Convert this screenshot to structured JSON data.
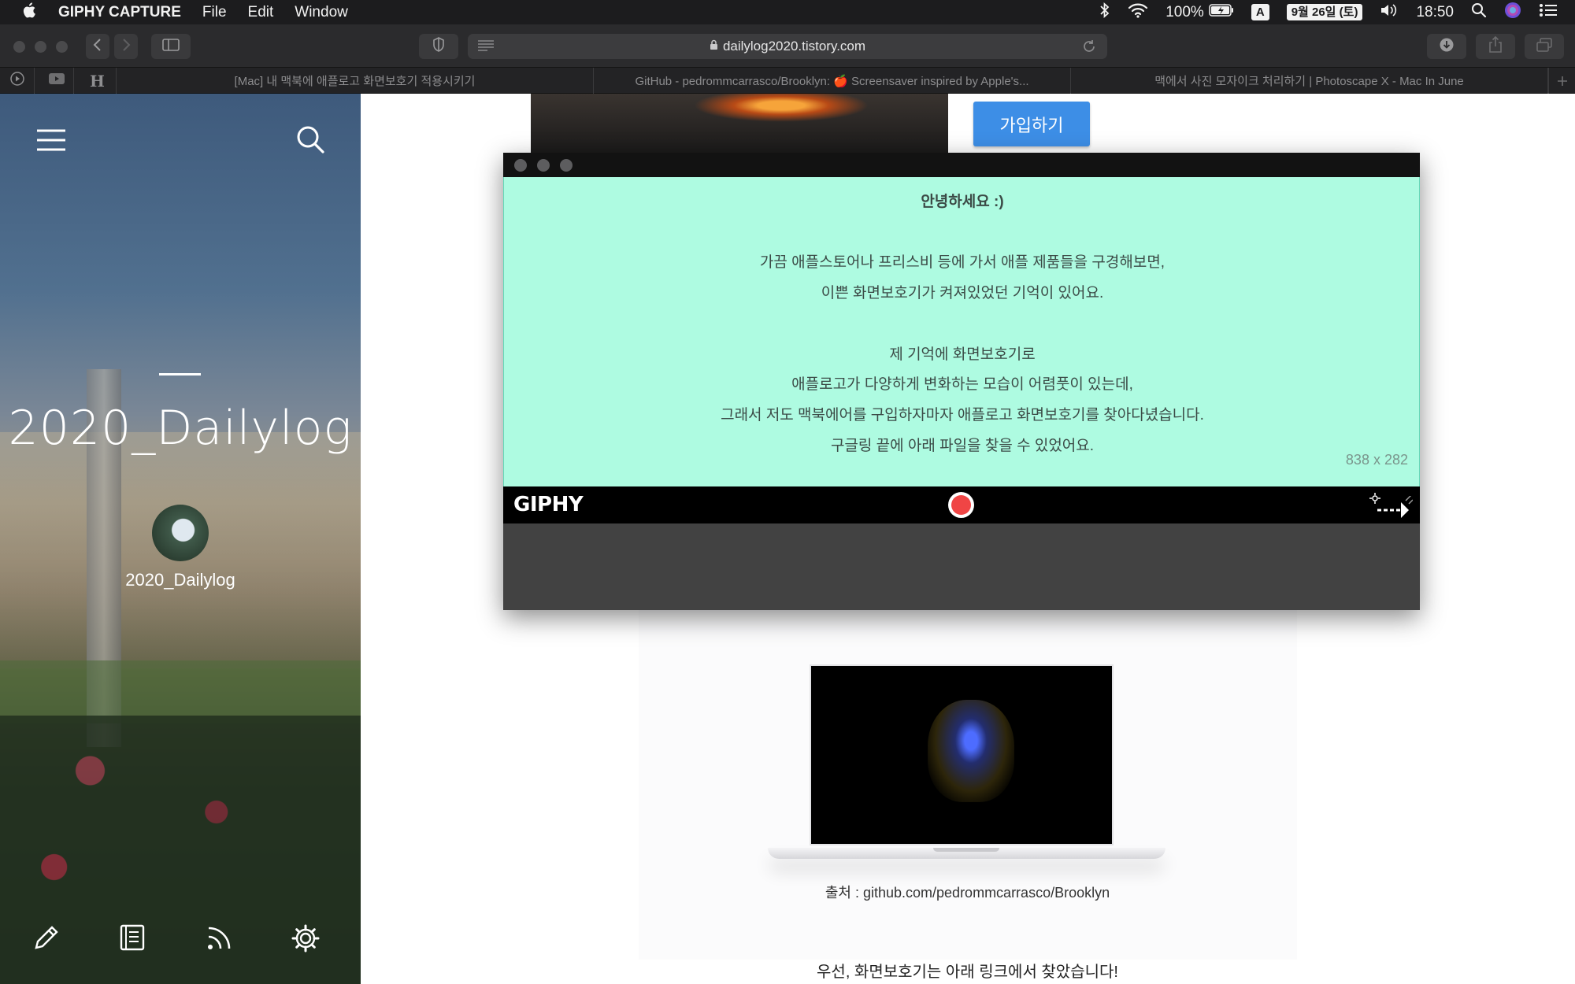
{
  "menubar": {
    "app_name": "GIPHY CAPTURE",
    "menus": [
      "File",
      "Edit",
      "Window"
    ],
    "battery": "100%",
    "input_source": "A",
    "date": "9월 26일 (토)",
    "time": "18:50"
  },
  "browser": {
    "url": "dailylog2020.tistory.com",
    "pinned_tabs": [
      "",
      "",
      "H"
    ],
    "tabs": [
      "[Mac] 내 맥북에 애플로고 화면보호기 적용시키기",
      "GitHub - pedrommcarrasco/Brooklyn: 🍎 Screensaver inspired by Apple's...",
      "맥에서 사진 모자이크 처리하기 | Photoscape X - Mac In June"
    ]
  },
  "sidebar": {
    "blog_title": "2020_Dailylog",
    "nickname": "2020_Dailylog"
  },
  "page": {
    "join_button": "가입하기",
    "caption_source": "출처 : github.com/pedrommcarrasco/Brooklyn",
    "caption_link": "우선, 화면보호기는 아래 링크에서 찾았습니다!"
  },
  "giphy": {
    "logo": "GIPHY",
    "capture_size": "838 x 282",
    "capture_text": {
      "greeting": "안녕하세요 :)",
      "line1": "가끔 애플스토어나 프리스비 등에 가서 애플 제품들을 구경해보면,",
      "line2": "이쁜 화면보호기가 켜져있었던 기억이 있어요.",
      "line3": "제 기억에 화면보호기로",
      "line4": "애플로고가 다양하게 변화하는 모습이 어렴풋이 있는데,",
      "line5": "그래서 저도 맥북에어를 구입하자마자 애플로고 화면보호기를 찾아다녔습니다.",
      "line6": "구글링 끝에 아래 파일을 찾을 수 있었어요."
    }
  },
  "colors": {
    "join_button": "#3d8ee6",
    "capture_overlay": "#a0fadc",
    "record": "#f04545"
  }
}
